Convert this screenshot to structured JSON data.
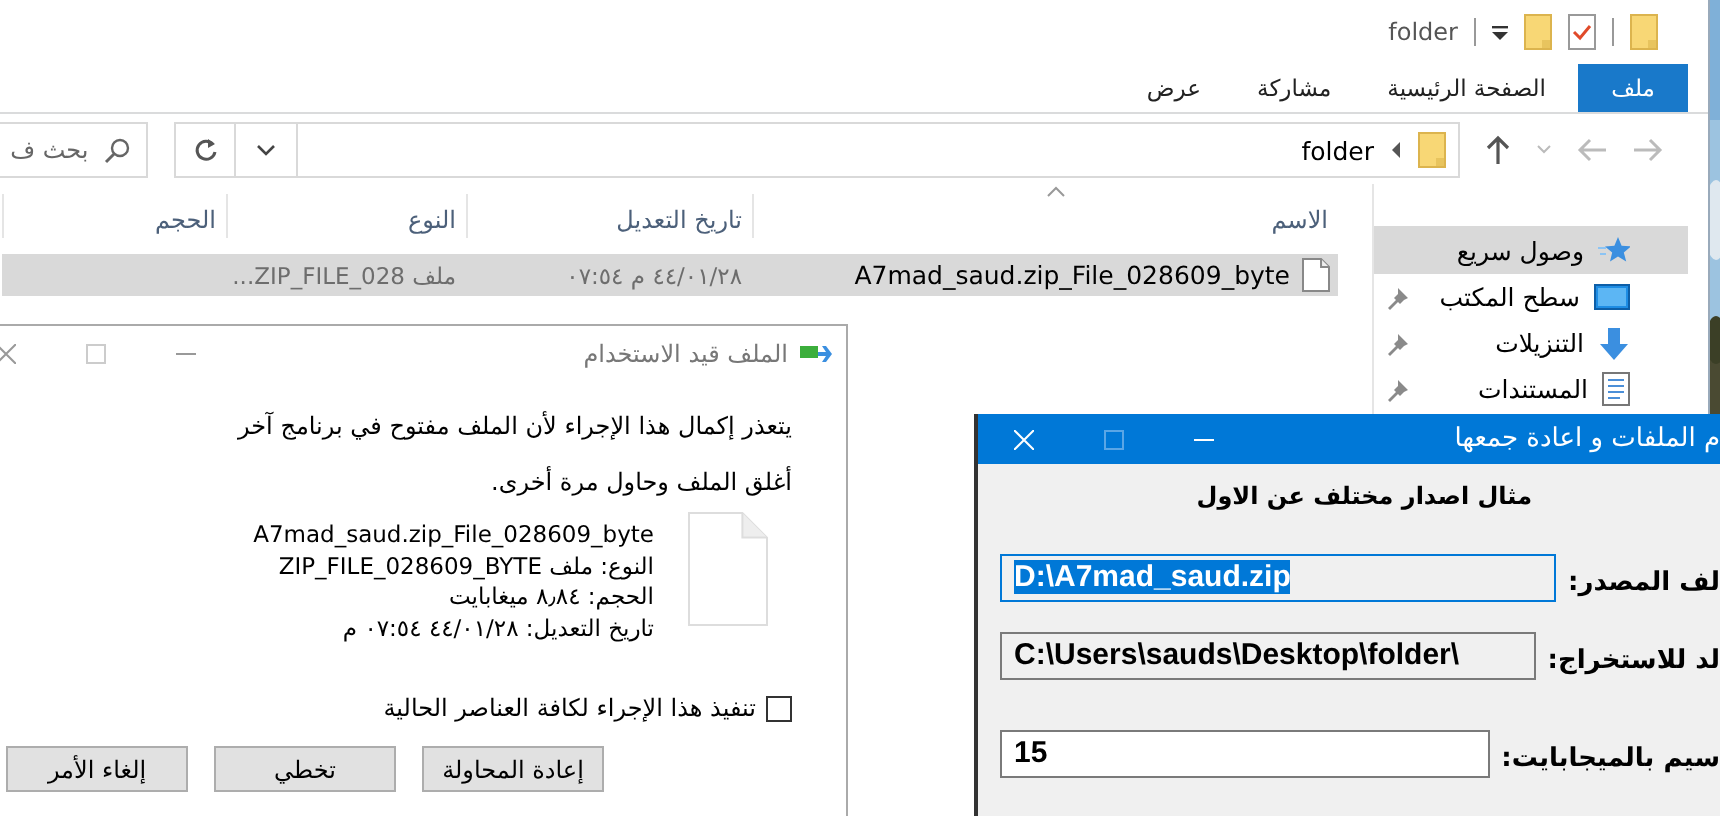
{
  "explorer": {
    "title": "folder",
    "tabs": [
      {
        "label": "ملف",
        "kind": "menu"
      },
      {
        "label": "الصفحة الرئيسية",
        "kind": "tab"
      },
      {
        "label": "مشاركة",
        "kind": "tab"
      },
      {
        "label": "عرض",
        "kind": "tab"
      }
    ],
    "address": "folder",
    "search": {
      "placeholder": "بحث ف"
    },
    "columns": [
      {
        "label": "الاسم",
        "sorted": true
      },
      {
        "label": "تاريخ التعديل",
        "sorted": false
      },
      {
        "label": "النوع",
        "sorted": false
      },
      {
        "label": "الحجم",
        "sorted": false
      }
    ],
    "rows": [
      {
        "name": "A7mad_saud.zip_File_028609_byte",
        "modified": "٤٤/٠١/٢٨ م ٠٧:٥٤",
        "type": "ملف ZIP_FILE_028...",
        "selected": true
      }
    ],
    "navigation": [
      {
        "label": "وصول سريع",
        "selected": true,
        "pinned": false
      },
      {
        "label": "سطح المكتب",
        "selected": false,
        "pinned": true
      },
      {
        "label": "التنزيلات",
        "selected": false,
        "pinned": true
      },
      {
        "label": "المستندات",
        "selected": false,
        "pinned": true
      }
    ]
  },
  "in_use_dialog": {
    "title": "الملف قيد الاستخدام",
    "message": "يتعذر إكمال هذا الإجراء لأن الملف مفتوح في برنامج آخر",
    "hint": "أغلق الملف وحاول مرة أخرى.",
    "file_details": [
      "A7mad_saud.zip_File_028609_byte",
      "النوع: ملف ZIP_FILE_028609_BYTE",
      "الحجم: ٨٫٨٤ ميغابايت",
      "تاريخ التعديل: ٤٤/٠١/٢٨ ٠٧:٥٤ م"
    ],
    "apply_to_all": {
      "label": "تنفيذ هذا الإجراء لكافة العناصر الحالية",
      "checked": false
    },
    "buttons": [
      "إعادة المحاولة",
      "تخطي",
      "إلغاء الأمر"
    ]
  },
  "split_dialog": {
    "title": "م الملفات و اعادة جمعها",
    "heading": "مثال اصدار مختلف عن الاول",
    "fields": [
      {
        "label": "لف المصدر:",
        "value": "D:\\A7mad_saud.zip",
        "selected": true,
        "readonly": false
      },
      {
        "label": "لد للاستخراج:",
        "value": "C:\\Users\\sauds\\Desktop\\folder\\",
        "selected": false,
        "readonly": true
      },
      {
        "label": "سيم بالميجابايت:",
        "value": "15",
        "selected": false,
        "readonly": false
      }
    ]
  }
}
